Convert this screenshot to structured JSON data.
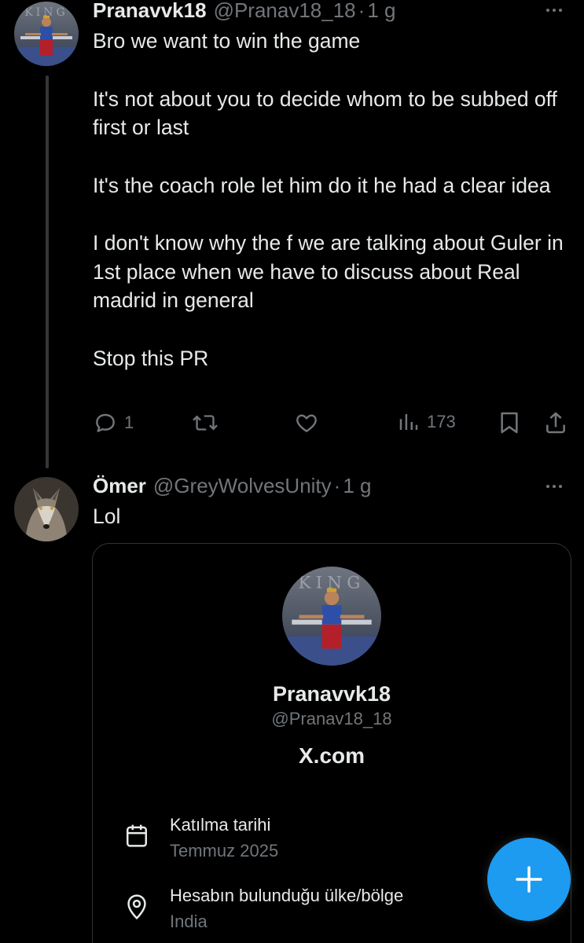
{
  "tweet1": {
    "name": "Pranavvk18",
    "handle": "@Pranav18_18",
    "separator": "·",
    "time": "1 g",
    "paragraphs": [
      "Bro we want to win the game",
      "It's not about you to decide whom to be subbed off first or last",
      "It's the coach role let him do it he had a clear idea",
      "I don't know why the f we are talking about Guler in 1st place when we have to discuss about Real madrid in general",
      "Stop this PR"
    ],
    "actions": {
      "reply_count": "1",
      "retweet_count": "",
      "like_count": "",
      "views_count": "173"
    },
    "avatar_caption": "KING"
  },
  "tweet2": {
    "name": "Ömer",
    "handle": "@GreyWolvesUnity",
    "separator": "·",
    "time": "1 g",
    "text": "Lol",
    "card": {
      "avatar_caption": "KING",
      "name": "Pranavvk18",
      "handle": "@Pranav18_18",
      "site": "X.com",
      "joined_label": "Katılma tarihi",
      "joined_value": "Temmuz 2025",
      "location_label": "Hesabın bulunduğu ülke/bölge",
      "location_value": "India"
    }
  },
  "icons": {
    "reply": "reply-icon",
    "retweet": "retweet-icon",
    "like": "heart-icon",
    "views": "views-icon",
    "bookmark": "bookmark-icon",
    "share": "share-icon",
    "more": "more-icon",
    "calendar": "calendar-icon",
    "location": "location-pin-icon",
    "compose": "plus-icon"
  },
  "colors": {
    "background": "#000000",
    "text": "#e7e9ea",
    "muted": "#71767b",
    "accent": "#1d9bf0",
    "border": "#2f3336"
  }
}
